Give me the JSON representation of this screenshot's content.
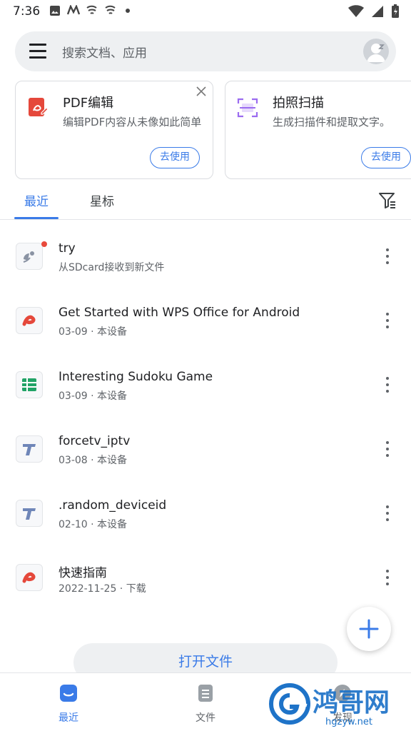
{
  "status_bar": {
    "time": "7:36"
  },
  "search": {
    "placeholder": "搜索文档、应用"
  },
  "cards": [
    {
      "title": "PDF编辑",
      "description": "编辑PDF内容从未像如此简单",
      "button": "去使用",
      "icon": "pdf-edit-icon"
    },
    {
      "title": "拍照扫描",
      "description": "生成扫描件和提取文字。",
      "button": "去使用",
      "icon": "scan-icon"
    }
  ],
  "tabs": {
    "recent": "最近",
    "starred": "星标"
  },
  "files": [
    {
      "name": "try",
      "meta": "从SDcard接收到新文件",
      "icon": "satellite-icon",
      "unread": true
    },
    {
      "name": "Get Started with WPS Office for Android",
      "meta": "03-09 · 本设备",
      "icon": "pdf-file-icon"
    },
    {
      "name": "Interesting Sudoku Game",
      "meta": "03-09 · 本设备",
      "icon": "spreadsheet-file-icon"
    },
    {
      "name": "forcetv_iptv",
      "meta": "03-08 · 本设备",
      "icon": "text-file-icon"
    },
    {
      "name": ".random_deviceid",
      "meta": "02-10 · 本设备",
      "icon": "text-file-icon"
    },
    {
      "name": "快速指南",
      "meta": "2022-11-25 · 下载",
      "icon": "pdf-file-icon"
    }
  ],
  "open_file": "打开文件",
  "bottom_nav": {
    "recent": "最近",
    "files": "文件",
    "discover": "发现"
  },
  "watermark": {
    "brand": "鸿哥网",
    "url": "hgzyw.net"
  },
  "colors": {
    "accent": "#3a7be8",
    "pdf_red": "#e5483b",
    "sheet_green": "#21a366",
    "text_gray": "#5f6368"
  }
}
